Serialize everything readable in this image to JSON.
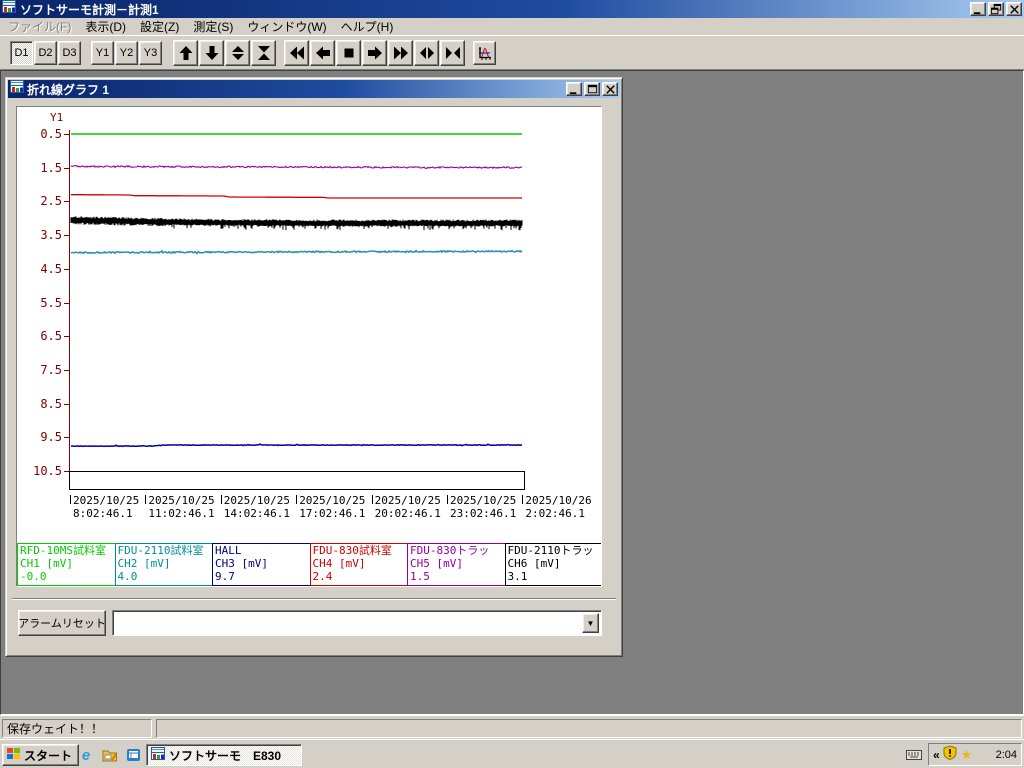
{
  "window": {
    "title": "ソフトサーモ計測－計測1"
  },
  "menu": {
    "items": [
      {
        "label": "ファイル(F)",
        "disabled": true
      },
      {
        "label": "表示(D)",
        "disabled": false
      },
      {
        "label": "設定(Z)",
        "disabled": false
      },
      {
        "label": "測定(S)",
        "disabled": false
      },
      {
        "label": "ウィンドウ(W)",
        "disabled": false
      },
      {
        "label": "ヘルプ(H)",
        "disabled": false
      }
    ]
  },
  "toolbar": {
    "d_buttons": [
      {
        "label": "D1",
        "pressed": true
      },
      {
        "label": "D2",
        "pressed": false
      },
      {
        "label": "D3",
        "pressed": false
      }
    ],
    "y_buttons": [
      {
        "label": "Y1",
        "pressed": false
      },
      {
        "label": "Y2",
        "pressed": false
      },
      {
        "label": "Y3",
        "pressed": false
      }
    ],
    "vertical_buttons": [
      {
        "icon": "arrow-up-icon"
      },
      {
        "icon": "arrow-down-icon"
      },
      {
        "icon": "expand-vertical-icon"
      },
      {
        "icon": "compress-vertical-icon"
      }
    ],
    "transport_buttons": [
      {
        "icon": "rewind-icon"
      },
      {
        "icon": "arrow-left-icon"
      },
      {
        "icon": "stop-icon"
      },
      {
        "icon": "arrow-right-icon"
      },
      {
        "icon": "fast-forward-icon"
      },
      {
        "icon": "expand-horizontal-icon"
      },
      {
        "icon": "compress-horizontal-icon"
      }
    ],
    "graph_button": {
      "icon": "graph-icon"
    }
  },
  "graph_window": {
    "title": "折れ線グラフ 1",
    "alarm_reset_label": "アラームリセット",
    "combo_value": ""
  },
  "chart_data": {
    "type": "line",
    "title": "折れ線グラフ 1",
    "y_axis": {
      "label": "Y1",
      "ticks": [
        0.5,
        1.5,
        2.5,
        3.5,
        4.5,
        5.5,
        6.5,
        7.5,
        8.5,
        9.5,
        10.5
      ],
      "min": 0.5,
      "max": 10.5,
      "inverted": true,
      "axis_color": "#800000"
    },
    "x_axis": {
      "tick_labels": [
        {
          "date": "2025/10/25",
          "time": "8:02:46.1"
        },
        {
          "date": "2025/10/25",
          "time": "11:02:46.1"
        },
        {
          "date": "2025/10/25",
          "time": "14:02:46.1"
        },
        {
          "date": "2025/10/25",
          "time": "17:02:46.1"
        },
        {
          "date": "2025/10/25",
          "time": "20:02:46.1"
        },
        {
          "date": "2025/10/25",
          "time": "23:02:46.1"
        },
        {
          "date": "2025/10/26",
          "time": "2:02:46.1"
        }
      ]
    },
    "series": [
      {
        "name": "RFD-10MS試料室",
        "channel": "CH1",
        "unit": "[mV]",
        "current_value": "-0.0",
        "color": "#00cc00",
        "width": 1.6,
        "keypoints": [
          [
            0,
            0.5
          ],
          [
            1,
            0.5
          ]
        ],
        "noise": 0,
        "style": "line"
      },
      {
        "name": "FDU-2110試料室",
        "channel": "CH2",
        "unit": "[mV]",
        "current_value": "4.0",
        "color": "#2a8fb0",
        "legend_color": "#008d99",
        "width": 1.5,
        "keypoints": [
          [
            0,
            4.02
          ],
          [
            0.5,
            4.0
          ],
          [
            1,
            3.98
          ]
        ],
        "noise": 0.02,
        "style": "line"
      },
      {
        "name": "HALL",
        "channel": "CH3",
        "unit": "[mV]",
        "current_value": "9.7",
        "color": "#0000a0",
        "legend_color": "#000080",
        "width": 1.5,
        "keypoints": [
          [
            0,
            9.76
          ],
          [
            0.18,
            9.76
          ],
          [
            0.2,
            9.73
          ],
          [
            1,
            9.73
          ]
        ],
        "noise": 0.008,
        "style": "line"
      },
      {
        "name": "FDU-830試料室",
        "channel": "CH4",
        "unit": "[mV]",
        "current_value": "2.4",
        "color": "#d00000",
        "width": 1.3,
        "keypoints": [
          [
            0,
            2.3
          ],
          [
            0.13,
            2.31
          ],
          [
            0.14,
            2.33
          ],
          [
            0.34,
            2.34
          ],
          [
            0.35,
            2.37
          ],
          [
            0.56,
            2.38
          ],
          [
            0.57,
            2.4
          ],
          [
            1,
            2.4
          ]
        ],
        "noise": 0,
        "style": "line"
      },
      {
        "name": "FDU-830トラッ",
        "channel": "CH5",
        "unit": "[mV]",
        "current_value": "1.5",
        "color": "#9400a0",
        "width": 1.1,
        "keypoints": [
          [
            0,
            1.46
          ],
          [
            0.5,
            1.48
          ],
          [
            1,
            1.5
          ]
        ],
        "noise": 0.022,
        "style": "line"
      },
      {
        "name": "FDU-2110トラッ",
        "channel": "CH6",
        "unit": "[mV]",
        "current_value": "3.1",
        "color": "#000000",
        "width": 1,
        "keypoints": [
          [
            0,
            3.05
          ],
          [
            0.25,
            3.12
          ],
          [
            0.5,
            3.15
          ],
          [
            1,
            3.15
          ]
        ],
        "noise": 0.07,
        "style": "noisy-band"
      }
    ]
  },
  "status": {
    "message": "保存ウェイト！！"
  },
  "taskbar": {
    "start_label": "スタート",
    "quick_launch": [
      "ie-icon",
      "show-desktop-icon",
      "outlook-icon"
    ],
    "task_button": {
      "label": "ソフトサーモ　E830",
      "active": true
    },
    "tray": {
      "chevron": "«",
      "clock": "2:04",
      "icons": [
        "keyboard-icon",
        "shield-icon",
        "star-icon"
      ]
    }
  }
}
